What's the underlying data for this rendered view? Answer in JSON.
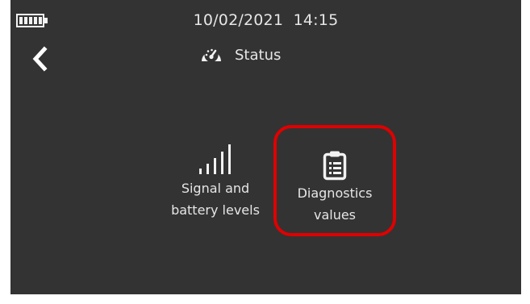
{
  "status_bar": {
    "battery_icon": "battery-full-icon",
    "date": "10/02/2021",
    "time": "14:15"
  },
  "header": {
    "back_icon": "chevron-left-icon",
    "title_icon": "speedometer-icon",
    "title": "Status"
  },
  "menu": {
    "items": [
      {
        "icon": "signal-bars-icon",
        "label_line1": "Signal and",
        "label_line2": "battery levels"
      },
      {
        "icon": "clipboard-list-icon",
        "label_line1": "Diagnostics",
        "label_line2": "values",
        "highlighted": true
      }
    ]
  },
  "colors": {
    "background": "#333333",
    "text": "#e6e6e6",
    "highlight": "#e00000"
  }
}
